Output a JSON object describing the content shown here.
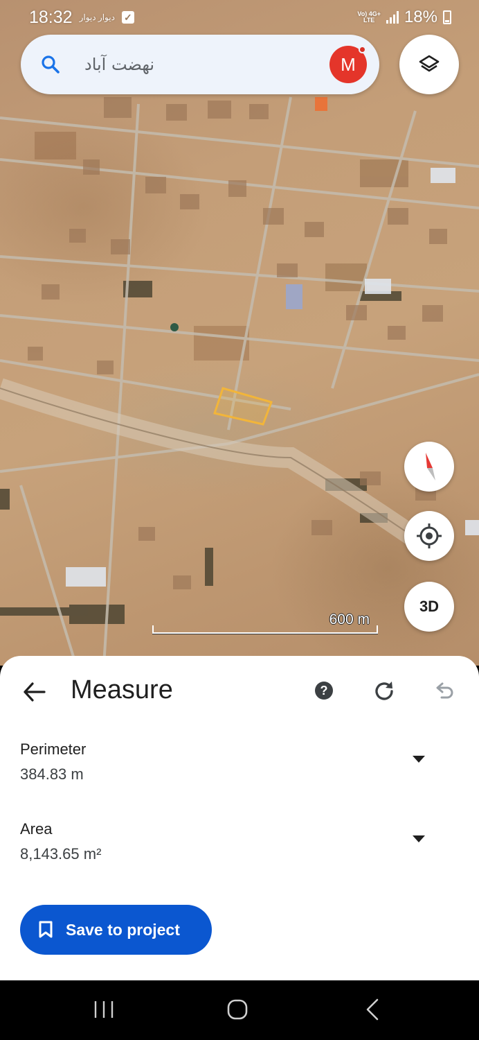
{
  "status_bar": {
    "time": "18:32",
    "notification_text": "دیوار دیوار",
    "network": "Vo) 4G+ LTE",
    "battery": "18%"
  },
  "search": {
    "query": "نهضت آباد",
    "avatar_letter": "M"
  },
  "map": {
    "scale_label": "600 m",
    "threed_label": "3D",
    "icons": [
      "search-icon",
      "layers-icon",
      "compass-icon",
      "my-location-icon"
    ]
  },
  "measure": {
    "title": "Measure",
    "perimeter_label": "Perimeter",
    "perimeter_value": "384.83 m",
    "area_label": "Area",
    "area_value": "8,143.65 m²",
    "save_label": "Save to project",
    "icons": [
      "back-arrow-icon",
      "help-icon",
      "reset-icon",
      "undo-icon",
      "dropdown-arrow-icon",
      "bookmark-icon"
    ]
  },
  "colors": {
    "accent": "#0b57d0",
    "avatar": "#e4352a",
    "polygon": "#f2b53a",
    "compass_red": "#e53935"
  }
}
